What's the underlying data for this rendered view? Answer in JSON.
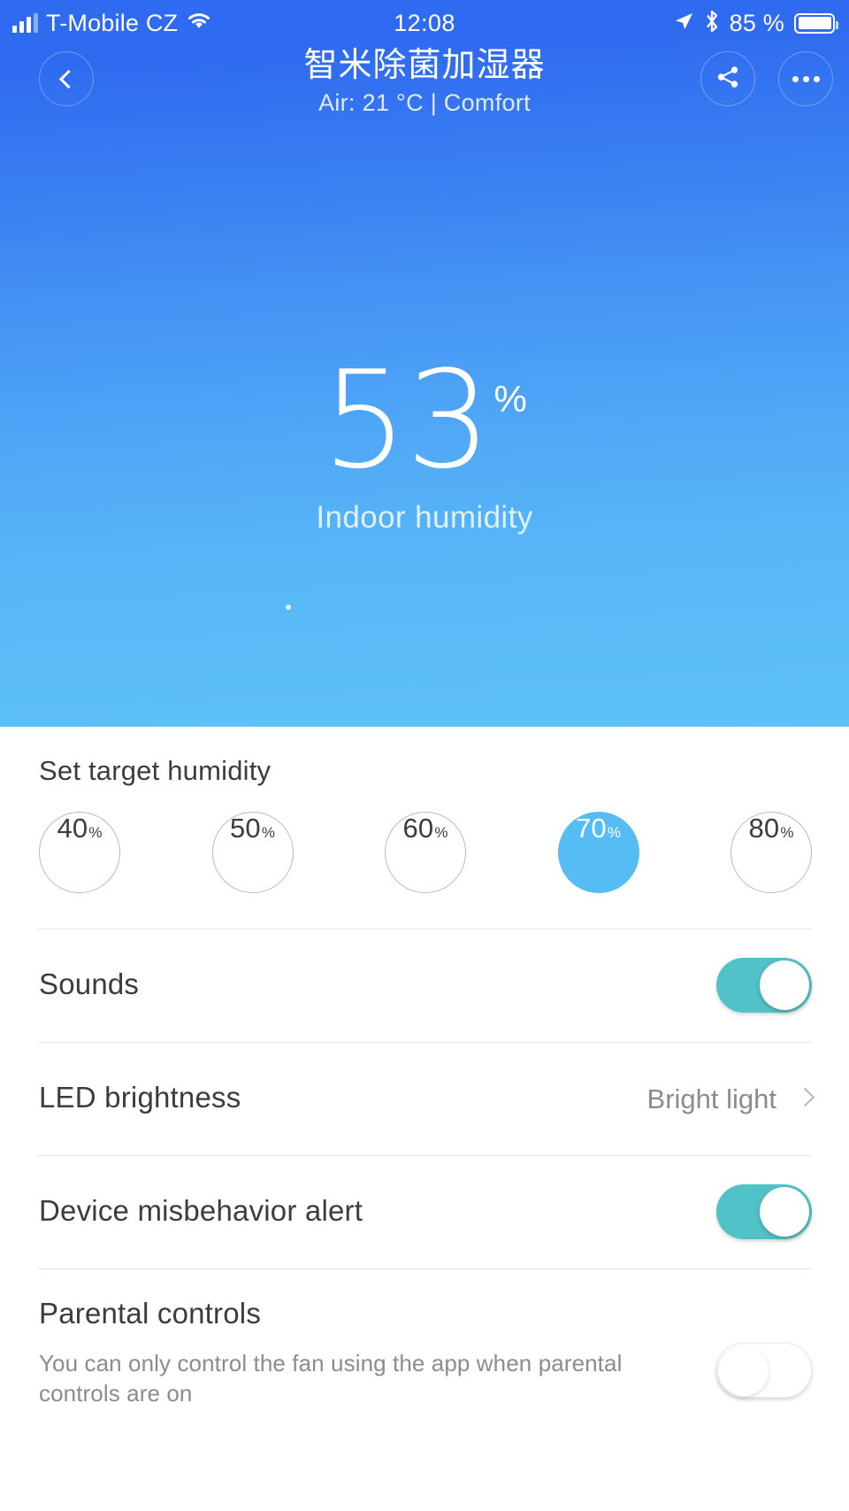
{
  "status_bar": {
    "carrier": "T-Mobile CZ",
    "time": "12:08",
    "battery_percent": "85 %",
    "icons": [
      "signal-bars-icon",
      "wifi-icon",
      "location-arrow-icon",
      "bluetooth-icon",
      "battery-icon"
    ]
  },
  "header": {
    "title": "智米除菌加湿器",
    "subtitle": "Air: 21 °C | Comfort",
    "back_icon": "chevron-left-icon",
    "share_icon": "share-icon",
    "more_icon": "more-options-icon"
  },
  "reading": {
    "value": "53",
    "unit": "%",
    "label": "Indoor humidity"
  },
  "target_humidity": {
    "section_title": "Set target humidity",
    "selected": "70",
    "options": [
      {
        "value": "40",
        "unit": "%",
        "selected": false
      },
      {
        "value": "50",
        "unit": "%",
        "selected": false
      },
      {
        "value": "60",
        "unit": "%",
        "selected": false
      },
      {
        "value": "70",
        "unit": "%",
        "selected": true
      },
      {
        "value": "80",
        "unit": "%",
        "selected": false
      }
    ]
  },
  "settings": {
    "sounds": {
      "label": "Sounds",
      "state": "on"
    },
    "led_brightness": {
      "label": "LED brightness",
      "value": "Bright light",
      "chevron": "chevron-right-icon"
    },
    "device_misbehavior_alert": {
      "label": "Device misbehavior alert",
      "state": "on"
    },
    "parental_controls": {
      "label": "Parental controls",
      "description": "You can only control the fan using the app when parental controls are on",
      "state": "off"
    }
  },
  "colors": {
    "hero_top": "#2f6bf0",
    "hero_bottom": "#5ec1f8",
    "chip_selected": "#56bdf4",
    "toggle_on": "#52c2c9",
    "text_primary": "#3c3c3c",
    "text_secondary": "#8c8c8c"
  }
}
